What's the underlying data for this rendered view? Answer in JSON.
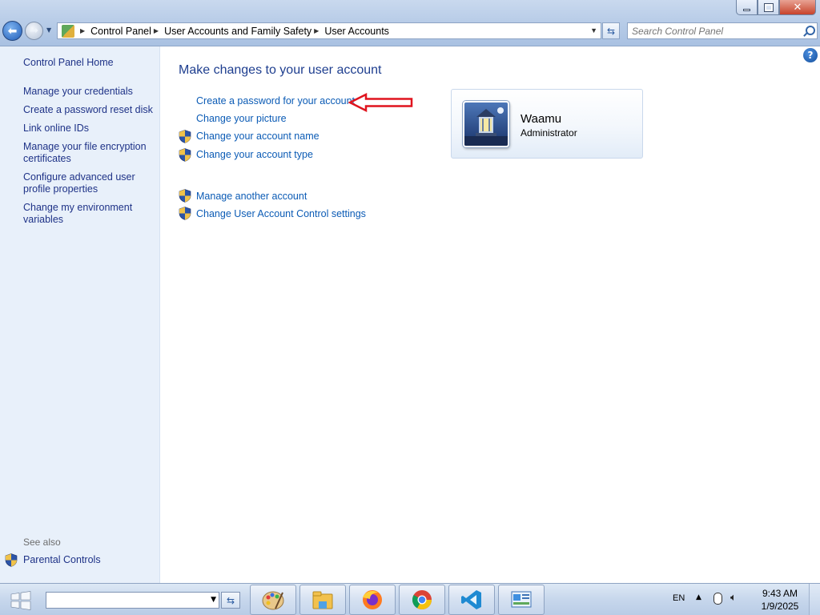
{
  "address_bar": {
    "crumbs": [
      "Control Panel",
      "User Accounts and Family Safety",
      "User Accounts"
    ]
  },
  "search": {
    "placeholder": "Search Control Panel"
  },
  "sidebar": {
    "home": "Control Panel Home",
    "links": [
      "Manage your credentials",
      "Create a password reset disk",
      "Link online IDs",
      "Manage your file encryption certificates",
      "Configure advanced user profile properties",
      "Change my environment variables"
    ],
    "see_also_label": "See also",
    "see_also_links": [
      "Parental Controls"
    ]
  },
  "main": {
    "title": "Make changes to your user account",
    "tasks": [
      {
        "label": "Create a password for your account",
        "shield": false
      },
      {
        "label": "Change your picture",
        "shield": false
      },
      {
        "label": "Change your account name",
        "shield": true
      },
      {
        "label": "Change your account type",
        "shield": true
      }
    ],
    "other_tasks": [
      {
        "label": "Manage another account",
        "shield": true
      },
      {
        "label": "Change User Account Control settings",
        "shield": true
      }
    ]
  },
  "account": {
    "name": "Waamu",
    "type": "Administrator"
  },
  "taskbar": {
    "apps": [
      "paint-icon",
      "file-explorer-icon",
      "firefox-icon",
      "chrome-icon",
      "vscode-icon",
      "control-panel-icon"
    ],
    "language": "EN",
    "time": "9:43 AM",
    "date": "1/9/2025"
  },
  "colors": {
    "link": "#0b5bb5",
    "sidebar_bg": "#e8f0fa",
    "annotation_arrow": "#e0141e"
  }
}
